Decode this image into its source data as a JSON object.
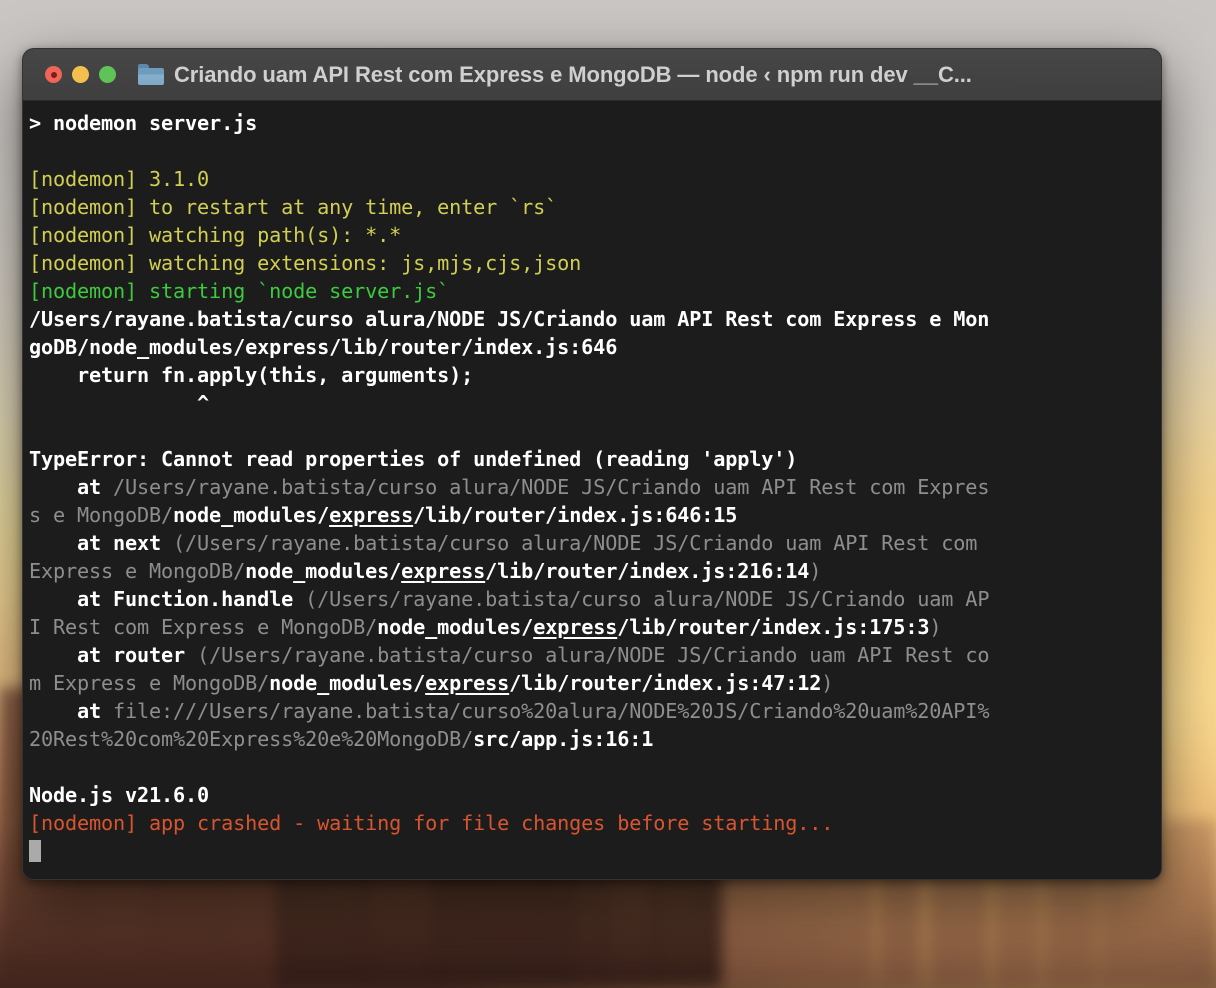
{
  "window": {
    "title": "Criando uam API Rest com Express e MongoDB — node ‹ npm run dev __C...",
    "traffic_lights": [
      {
        "name": "close",
        "color": "#f0655a"
      },
      {
        "name": "minimize",
        "color": "#f3bf4f"
      },
      {
        "name": "maximize",
        "color": "#5fc457"
      }
    ],
    "folder_icon": "folder-icon"
  },
  "colors": {
    "terminal_bg": "#1c1c1c",
    "titlebar_bg": "#434242",
    "white": "#ffffff",
    "dim": "#8e8e8e",
    "yellow": "#d1cf52",
    "green": "#3ec93e",
    "red": "#d9552f",
    "cursor": "#aaaaaa"
  },
  "terminal": {
    "prompt_line": "> nodemon server.js",
    "lines": [
      {
        "id": "l01",
        "text": "> nodemon server.js",
        "style": "white"
      },
      {
        "id": "l02",
        "text": "",
        "style": "blank"
      },
      {
        "id": "l03",
        "text": "[nodemon] 3.1.0",
        "style": "yellow"
      },
      {
        "id": "l04",
        "text": "[nodemon] to restart at any time, enter `rs`",
        "style": "yellow"
      },
      {
        "id": "l05",
        "text": "[nodemon] watching path(s): *.*",
        "style": "yellow"
      },
      {
        "id": "l06",
        "text": "[nodemon] watching extensions: js,mjs,cjs,json",
        "style": "yellow"
      },
      {
        "id": "l07",
        "text": "[nodemon] starting `node server.js`",
        "style": "green"
      },
      {
        "id": "l08",
        "text": "/Users/rayane.batista/curso alura/NODE JS/Criando uam API Rest com Express e Mon",
        "style": "white"
      },
      {
        "id": "l09",
        "text": "goDB/node_modules/express/lib/router/index.js:646",
        "style": "white"
      },
      {
        "id": "l10",
        "text": "    return fn.apply(this, arguments);",
        "style": "white"
      },
      {
        "id": "l11",
        "text": "              ^",
        "style": "white"
      },
      {
        "id": "l12",
        "text": "",
        "style": "blank"
      },
      {
        "id": "l13",
        "text": "TypeError: Cannot read properties of undefined (reading 'apply')",
        "style": "white"
      },
      {
        "id": "l14",
        "style": "mixed",
        "segments": [
          {
            "t": "    at ",
            "c": "white"
          },
          {
            "t": "/Users/rayane.batista/curso alura/NODE JS/Criando uam API Rest com Expres",
            "c": "dim"
          }
        ]
      },
      {
        "id": "l15",
        "style": "mixed",
        "segments": [
          {
            "t": "s e MongoDB/",
            "c": "dim"
          },
          {
            "t": "node_modules/",
            "c": "white"
          },
          {
            "t": "express",
            "c": "white-underline"
          },
          {
            "t": "/lib/router/index.js:646:15",
            "c": "white"
          }
        ]
      },
      {
        "id": "l16",
        "style": "mixed",
        "segments": [
          {
            "t": "    at next ",
            "c": "white"
          },
          {
            "t": "(/Users/rayane.batista/curso alura/NODE JS/Criando uam API Rest com",
            "c": "dim"
          }
        ]
      },
      {
        "id": "l17",
        "style": "mixed",
        "segments": [
          {
            "t": "Express e MongoDB/",
            "c": "dim"
          },
          {
            "t": "node_modules/",
            "c": "white"
          },
          {
            "t": "express",
            "c": "white-underline"
          },
          {
            "t": "/lib/router/index.js:216:14",
            "c": "white"
          },
          {
            "t": ")",
            "c": "dim"
          }
        ]
      },
      {
        "id": "l18",
        "style": "mixed",
        "segments": [
          {
            "t": "    at Function.handle ",
            "c": "white"
          },
          {
            "t": "(/Users/rayane.batista/curso alura/NODE JS/Criando uam AP",
            "c": "dim"
          }
        ]
      },
      {
        "id": "l19",
        "style": "mixed",
        "segments": [
          {
            "t": "I Rest com Express e MongoDB/",
            "c": "dim"
          },
          {
            "t": "node_modules/",
            "c": "white"
          },
          {
            "t": "express",
            "c": "white-underline"
          },
          {
            "t": "/lib/router/index.js:175:3",
            "c": "white"
          },
          {
            "t": ")",
            "c": "dim"
          }
        ]
      },
      {
        "id": "l20",
        "style": "mixed",
        "segments": [
          {
            "t": "    at router ",
            "c": "white"
          },
          {
            "t": "(/Users/rayane.batista/curso alura/NODE JS/Criando uam API Rest co",
            "c": "dim"
          }
        ]
      },
      {
        "id": "l21",
        "style": "mixed",
        "segments": [
          {
            "t": "m Express e MongoDB/",
            "c": "dim"
          },
          {
            "t": "node_modules/",
            "c": "white"
          },
          {
            "t": "express",
            "c": "white-underline"
          },
          {
            "t": "/lib/router/index.js:47:12",
            "c": "white"
          },
          {
            "t": ")",
            "c": "dim"
          }
        ]
      },
      {
        "id": "l22",
        "style": "mixed",
        "segments": [
          {
            "t": "    at ",
            "c": "white"
          },
          {
            "t": "file:///Users/rayane.batista/curso%20alura/NODE%20JS/Criando%20uam%20API%",
            "c": "dim"
          }
        ]
      },
      {
        "id": "l23",
        "style": "mixed",
        "segments": [
          {
            "t": "20Rest%20com%20Express%20e%20MongoDB/",
            "c": "dim"
          },
          {
            "t": "src/app.js:16:1",
            "c": "white"
          }
        ]
      },
      {
        "id": "l24",
        "text": "",
        "style": "blank"
      },
      {
        "id": "l25",
        "text": "Node.js v21.6.0",
        "style": "white"
      },
      {
        "id": "l26",
        "text": "[nodemon] app crashed - waiting for file changes before starting...",
        "style": "red"
      }
    ],
    "cursor": {
      "name": "block-cursor",
      "visible": true
    }
  }
}
